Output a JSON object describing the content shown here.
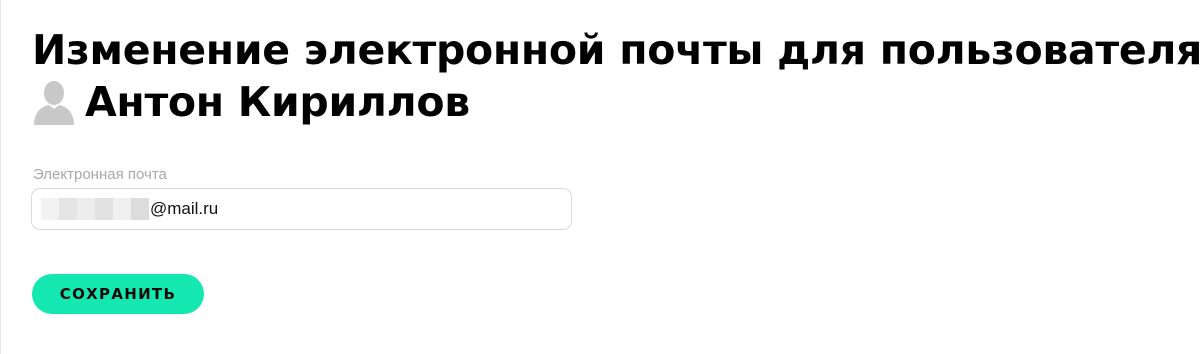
{
  "header": {
    "title_line1": "Изменение электронной почты для пользователя",
    "user_name": "Антон Кириллов",
    "user_icon": "user-silhouette-icon"
  },
  "form": {
    "email_label": "Электронная почта",
    "email_value_visible": "@mail.ru",
    "email_value_masked": true
  },
  "actions": {
    "save_label": "СОХРАНИТЬ"
  },
  "colors": {
    "accent": "#14e8b0",
    "label": "#a8a8a8",
    "border": "#d9d9d9",
    "icon": "#c8c8c8"
  }
}
